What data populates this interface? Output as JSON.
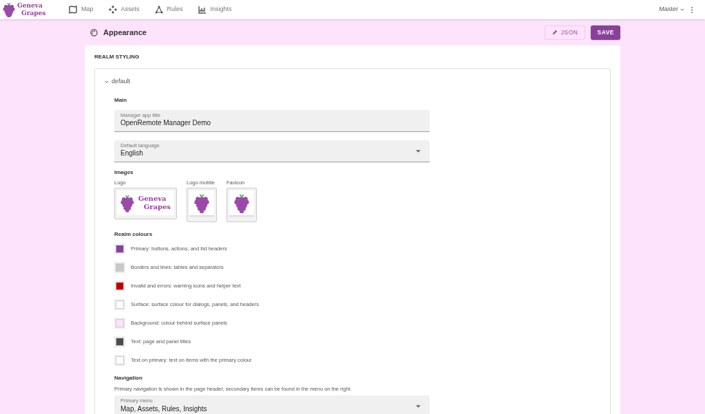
{
  "header": {
    "logo_text": [
      "Geneva",
      "Grapes"
    ],
    "nav": [
      {
        "label": "Map",
        "kind": "map"
      },
      {
        "label": "Assets",
        "kind": "assets"
      },
      {
        "label": "Rules",
        "kind": "rules"
      },
      {
        "label": "Insights",
        "kind": "insights"
      }
    ],
    "realm": "Master"
  },
  "page": {
    "title": "Appearance",
    "buttons": {
      "json": "JSON",
      "save": "SAVE"
    }
  },
  "card": {
    "heading": "REALM STYLING",
    "panel": {
      "label": "default",
      "expanded": true,
      "main": {
        "heading": "Main",
        "fields": [
          {
            "kind": "text",
            "label": "Manager app title",
            "value": "OpenRemote Manager Demo"
          },
          {
            "kind": "select",
            "label": "Default language",
            "value": "English"
          }
        ]
      },
      "images": {
        "heading": "Images",
        "items": [
          {
            "kind": "wide",
            "label": "Logo",
            "logo_text": [
              "Geneva",
              "Grapes"
            ]
          },
          {
            "kind": "square",
            "label": "Logo mobile"
          },
          {
            "kind": "square",
            "label": "Favicon"
          }
        ]
      },
      "colours": {
        "heading": "Realm colours",
        "items": [
          {
            "label": "Primary: buttons, actions, and list headers",
            "color": "#89409b"
          },
          {
            "label": "Borders and lines: tables and separators",
            "color": "#c8c8c8"
          },
          {
            "label": "Invalid and errors: warning icons and helper text",
            "color": "#c00000"
          },
          {
            "label": "Surface: surface colour for dialogs, panels, and headers",
            "color": "#ffffff"
          },
          {
            "label": "Background: colour behind surface panels",
            "color": "#ffe3fb"
          },
          {
            "label": "Text: page and panel titles",
            "color": "#4c4c4c"
          },
          {
            "label": "Text on primary: text on items with the primary colour",
            "color": "#ffffff"
          }
        ]
      },
      "navigation": {
        "heading": "Navigation",
        "description": "Primary navigation is shown in the page header, secondary items can be found in the menu on the right.",
        "field": {
          "kind": "select",
          "label": "Primary menu",
          "value": "Map, Assets, Rules, Insights"
        }
      }
    }
  }
}
